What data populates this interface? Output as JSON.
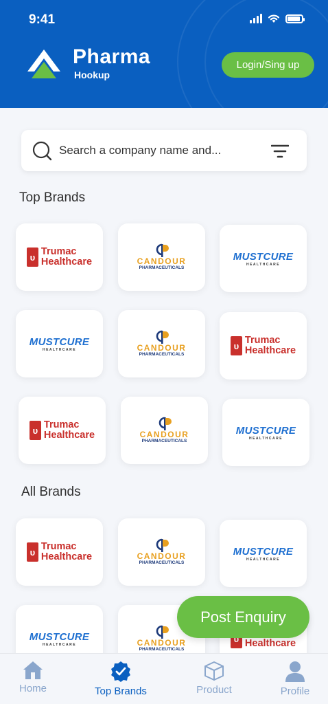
{
  "status_bar": {
    "time": "9:41"
  },
  "header": {
    "app_name": "Pharma",
    "app_sub": "Hookup",
    "login_label": "Login/Sing up"
  },
  "search": {
    "placeholder": "Search a company name and..."
  },
  "top_brands": {
    "title": "Top Brands",
    "cards": [
      "trumac",
      "candour",
      "mustcure",
      "mustcure",
      "candour",
      "trumac",
      "trumac",
      "candour",
      "mustcure"
    ]
  },
  "all_brands": {
    "title": "All Brands",
    "cards": [
      "trumac",
      "candour",
      "mustcure",
      "mustcure",
      "candour",
      "trumac"
    ]
  },
  "brands": {
    "trumac": {
      "line1": "Trumac",
      "line2": "Healthcare"
    },
    "candour": {
      "name": "CANDOUR",
      "sub": "PHARMACEUTICALS"
    },
    "mustcure": {
      "name": "MUSTCURE",
      "sub": "HEALTHCARE"
    }
  },
  "fab": {
    "label": "Post Enquiry"
  },
  "bottom_nav": {
    "items": [
      {
        "label": "Home",
        "icon": "home-icon"
      },
      {
        "label": "Top Brands",
        "icon": "verified-badge-icon"
      },
      {
        "label": "Product",
        "icon": "box-icon"
      },
      {
        "label": "Profile",
        "icon": "user-icon"
      }
    ],
    "active_index": 1
  },
  "colors": {
    "primary": "#0a5fc0",
    "accent_green": "#6abf45",
    "trumac_red": "#c9302c",
    "candour_orange": "#e8a020",
    "mustcure_blue": "#1e6fd0"
  }
}
